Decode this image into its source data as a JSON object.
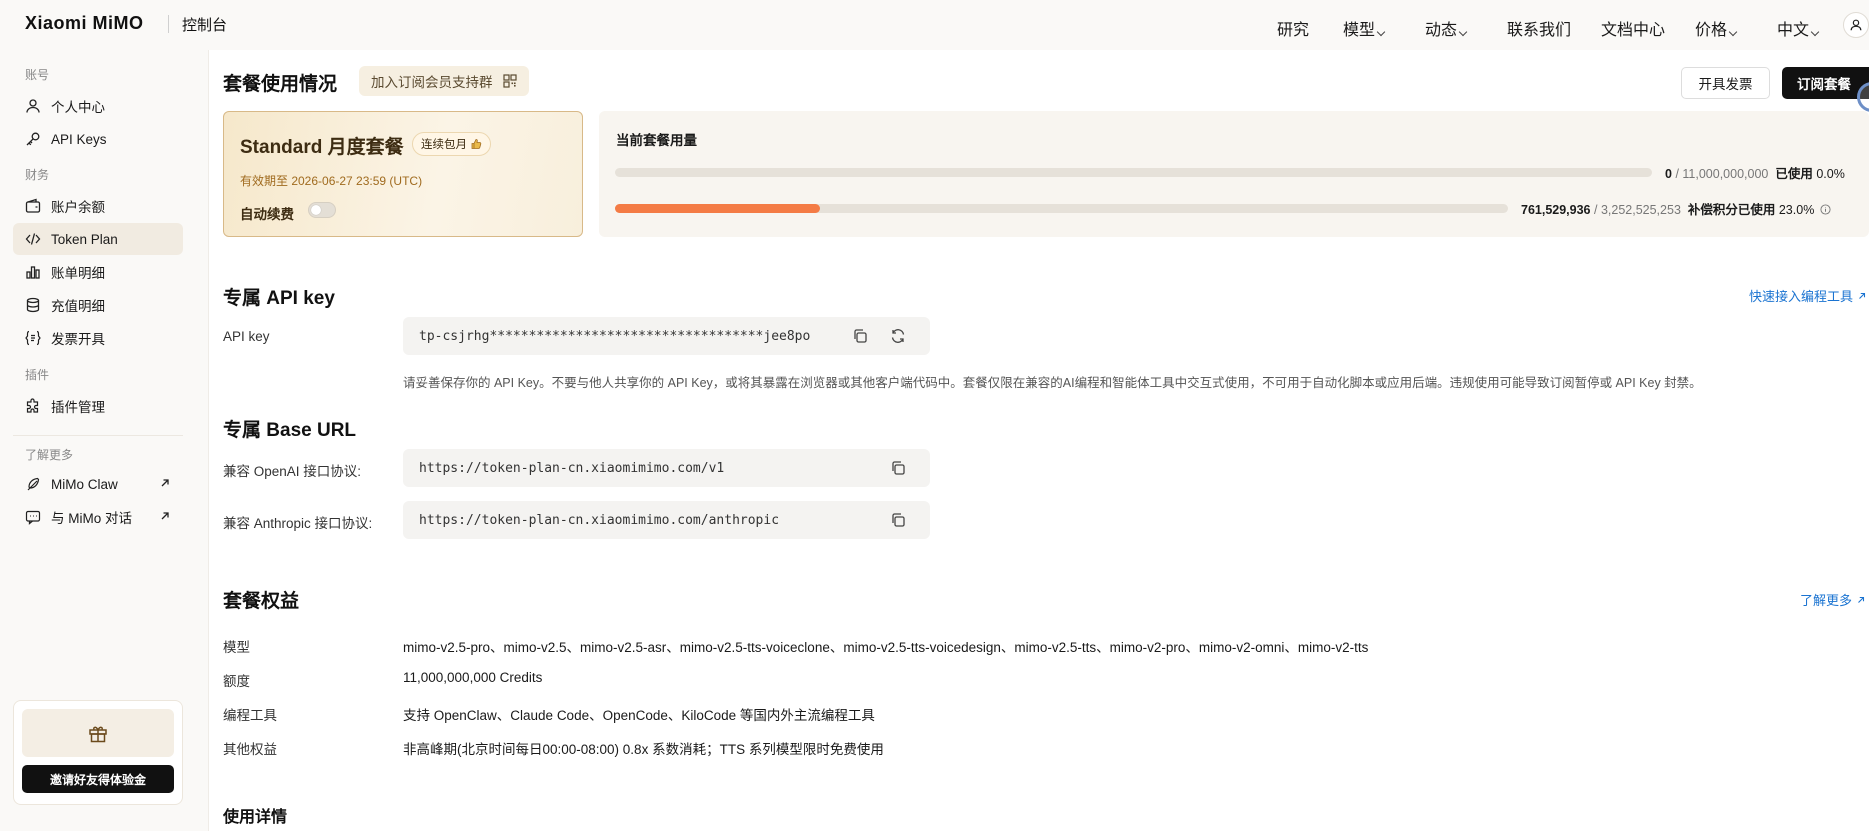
{
  "header": {
    "brand": "Xiaomi MiMO",
    "console": "控制台",
    "nav": [
      {
        "label": "研究",
        "dropdown": false
      },
      {
        "label": "模型",
        "dropdown": true
      },
      {
        "label": "动态",
        "dropdown": true
      },
      {
        "label": "联系我们",
        "dropdown": false
      },
      {
        "label": "文档中心",
        "dropdown": false
      },
      {
        "label": "价格",
        "dropdown": true
      },
      {
        "label": "中文",
        "dropdown": true
      }
    ]
  },
  "sidebar": {
    "groups": {
      "account": "账号",
      "finance": "财务",
      "plugins": "插件",
      "more": "了解更多"
    },
    "items": [
      {
        "label": "个人中心",
        "icon": "user-icon"
      },
      {
        "label": "API Keys",
        "icon": "key-icon"
      },
      {
        "label": "账户余额",
        "icon": "wallet-icon"
      },
      {
        "label": "Token Plan",
        "icon": "code-icon",
        "active": true
      },
      {
        "label": "账单明细",
        "icon": "bar-chart-icon"
      },
      {
        "label": "充值明细",
        "icon": "coins-icon"
      },
      {
        "label": "发票开具",
        "icon": "invoice-icon"
      },
      {
        "label": "插件管理",
        "icon": "puzzle-icon"
      },
      {
        "label": "MiMo Claw",
        "icon": "feather-icon",
        "external": true
      },
      {
        "label": "与 MiMo 对话",
        "icon": "chat-icon",
        "external": true
      }
    ],
    "gift": {
      "button": "邀请好友得体验金"
    }
  },
  "usage_section": {
    "title": "套餐使用情况",
    "pill": "加入订阅会员支持群",
    "invoice_button": "开具发票",
    "subscribe_button": "订阅套餐"
  },
  "plan": {
    "name": "Standard 月度套餐",
    "badge": "连续包月",
    "expires": "有效期至 2026-06-27 23:59 (UTC)",
    "auto_renew_label": "自动续费",
    "auto_renew": false
  },
  "usage": {
    "title": "当前套餐用量",
    "rows": [
      {
        "used": "0",
        "total": "11,000,000,000",
        "label": "已使用",
        "percent_text": "0.0%",
        "fraction": 0.0
      },
      {
        "used": "761,529,936",
        "total": "3,252,525,253",
        "label": "补偿积分已使用",
        "percent_text": "23.0%",
        "fraction": 0.23
      }
    ]
  },
  "api_key": {
    "title": "专属 API key",
    "quick_link": "快速接入编程工具",
    "label": "API key",
    "value": "tp-csjrhg***********************************jee8po",
    "note": "请妥善保存你的 API Key。不要与他人共享你的 API Key，或将其暴露在浏览器或其他客户端代码中。套餐仅限在兼容的AI编程和智能体工具中交互式使用，不可用于自动化脚本或应用后端。违规使用可能导致订阅暂停或 API Key 封禁。"
  },
  "base_url": {
    "title": "专属 Base URL",
    "openai_label": "兼容 OpenAI 接口协议:",
    "openai_url": "https://token-plan-cn.xiaomimimo.com/v1",
    "anthropic_label": "兼容 Anthropic 接口协议:",
    "anthropic_url": "https://token-plan-cn.xiaomimimo.com/anthropic"
  },
  "benefits": {
    "title": "套餐权益",
    "more_link": "了解更多",
    "rows": [
      {
        "label": "模型",
        "value": "mimo-v2.5-pro、mimo-v2.5、mimo-v2.5-asr、mimo-v2.5-tts-voiceclone、mimo-v2.5-tts-voicedesign、mimo-v2.5-tts、mimo-v2-pro、mimo-v2-omni、mimo-v2-tts"
      },
      {
        "label": "额度",
        "value": "11,000,000,000 Credits"
      },
      {
        "label": "编程工具",
        "value": "支持 OpenClaw、Claude Code、OpenCode、KiloCode 等国内外主流编程工具"
      },
      {
        "label": "其他权益",
        "value": "非高峰期(北京时间每日00:00-08:00) 0.8x 系数消耗；TTS 系列模型限时免费使用"
      }
    ]
  },
  "details": {
    "title": "使用详情"
  },
  "colors": {
    "accent": "#f47b45",
    "link": "#1a73d1",
    "dark": "#111111"
  }
}
